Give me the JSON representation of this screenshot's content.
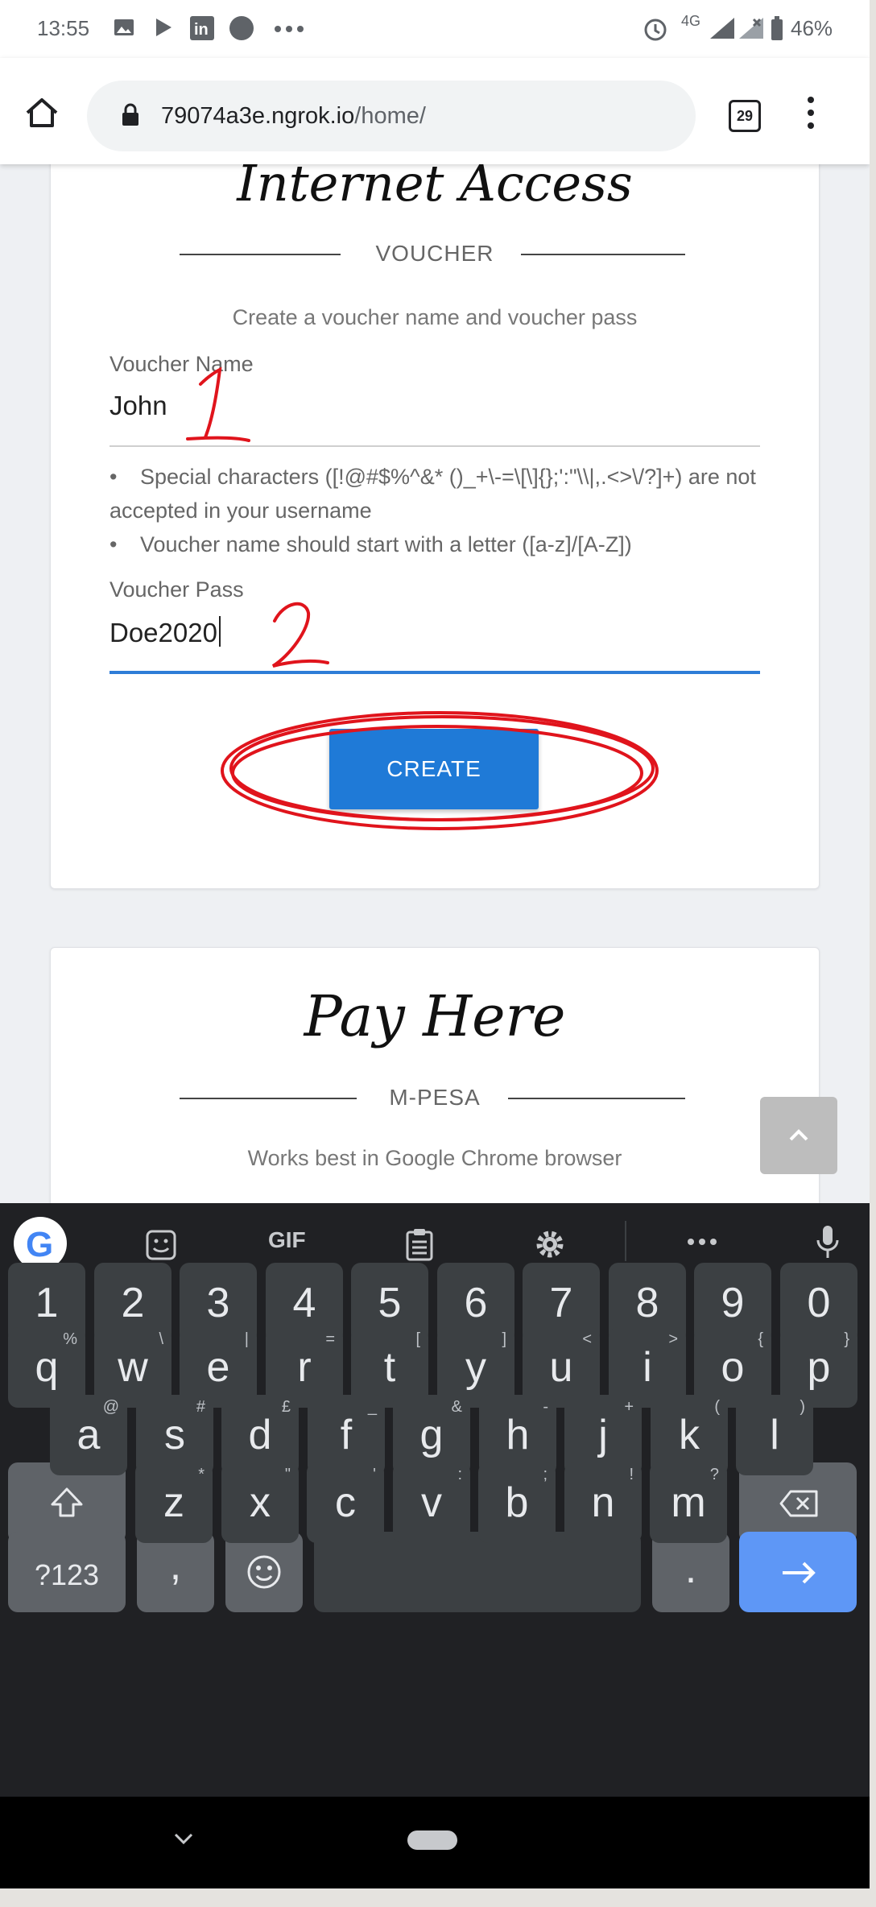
{
  "status_bar": {
    "time": "13:55",
    "network": "4G",
    "battery": "46%",
    "icons": [
      "image-icon",
      "play-store-icon",
      "linkedin-icon",
      "circle-icon",
      "more-icon",
      "alarm-icon",
      "signal-icon",
      "battery-icon"
    ]
  },
  "browser": {
    "url_host": "79074a3e.ngrok.io",
    "url_path": "/home/",
    "tab_count": "29"
  },
  "voucher_card": {
    "title": "Internet Access",
    "section_label": "VOUCHER",
    "hint": "Create a voucher name and voucher pass",
    "name_label": "Voucher Name",
    "name_value": "John",
    "rules": [
      "Special characters ([!@#$%^&* ()_+\\-=\\[\\]{};':\"\\\\|,.<>\\/?]+) are not accepted in your username",
      "Voucher name should start with a letter ([a-z]/[A-Z])"
    ],
    "pass_label": "Voucher Pass",
    "pass_value": "Doe2020",
    "create_label": "CREATE",
    "annotation_1": "1",
    "annotation_2": "2"
  },
  "pay_card": {
    "title": "Pay Here",
    "section_label": "M-PESA",
    "hint": "Works best in Google Chrome browser"
  },
  "keyboard": {
    "toolbar": [
      "google-icon",
      "sticker-icon",
      "GIF",
      "clipboard-icon",
      "settings-icon",
      "more-icon",
      "mic-icon"
    ],
    "gif_label": "GIF",
    "row_numbers": [
      "1",
      "2",
      "3",
      "4",
      "5",
      "6",
      "7",
      "8",
      "9",
      "0"
    ],
    "row_q": [
      [
        "q",
        "%"
      ],
      [
        "w",
        "\\"
      ],
      [
        "e",
        "|"
      ],
      [
        "r",
        "="
      ],
      [
        "t",
        "["
      ],
      [
        "y",
        "]"
      ],
      [
        "u",
        "<"
      ],
      [
        "i",
        ">"
      ],
      [
        "o",
        "{"
      ],
      [
        "p",
        "}"
      ]
    ],
    "row_a": [
      [
        "a",
        "@"
      ],
      [
        "s",
        "#"
      ],
      [
        "d",
        "£"
      ],
      [
        "f",
        "_"
      ],
      [
        "g",
        "&"
      ],
      [
        "h",
        "-"
      ],
      [
        "j",
        "+"
      ],
      [
        "k",
        "("
      ],
      [
        "l",
        ")"
      ]
    ],
    "row_z": [
      [
        "z",
        "*"
      ],
      [
        "x",
        "\""
      ],
      [
        "c",
        "'"
      ],
      [
        "v",
        ":"
      ],
      [
        "b",
        ";"
      ],
      [
        "n",
        "!"
      ],
      [
        "m",
        "?"
      ]
    ],
    "symbols_label": "?123",
    "comma": ",",
    "period": "."
  },
  "colors": {
    "primary_button": "#1f7ad7",
    "annotation": "#e0141c",
    "enter_key": "#5e97f6",
    "keyboard_bg": "#202124"
  }
}
